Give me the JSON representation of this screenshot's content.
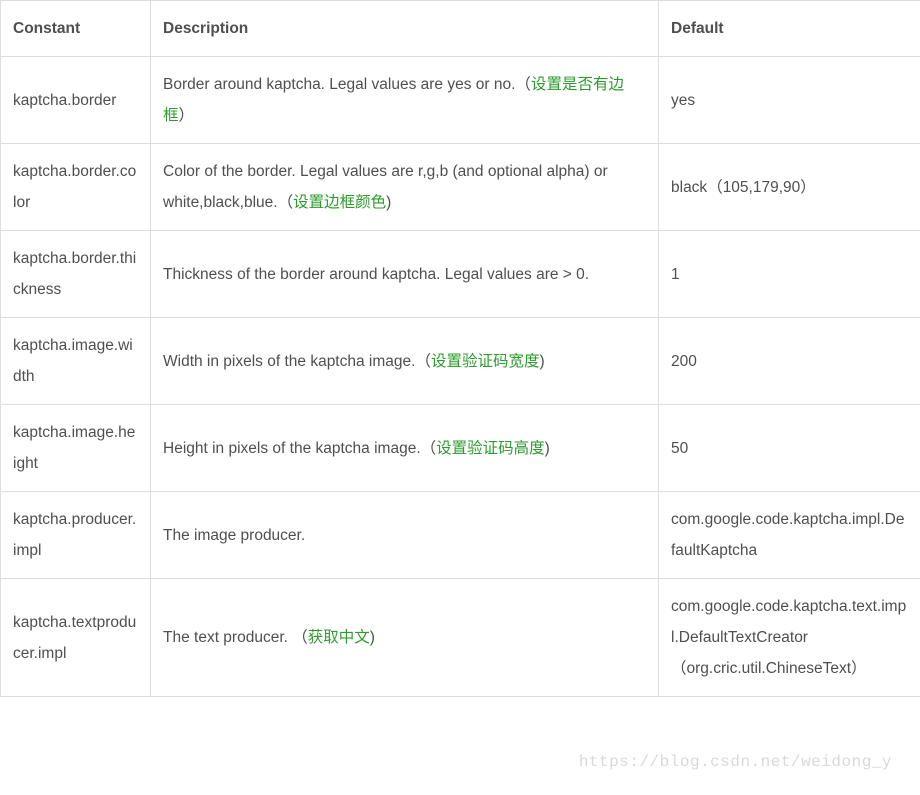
{
  "headers": {
    "constant": "Constant",
    "description": "Description",
    "default": "Default"
  },
  "rows": [
    {
      "constant": "kaptcha.border",
      "desc_text": "Border around kaptcha. Legal values are yes or no.",
      "desc_note_prefix": "（",
      "desc_note": "设置是否有边框",
      "desc_note_suffix": "）",
      "default_text": "yes",
      "default_note": ""
    },
    {
      "constant": "kaptcha.border.color",
      "desc_text": "Color of the border. Legal values are r,g,b (and optional alpha) or white,black,blue.",
      "desc_note_prefix": "（",
      "desc_note": "设置边框颜色",
      "desc_note_suffix": ")",
      "default_text": "black",
      "default_note": "（105,179,90）"
    },
    {
      "constant": "kaptcha.border.thickness",
      "desc_text": "Thickness of the border around kaptcha. Legal values are > 0.",
      "desc_note_prefix": "",
      "desc_note": "",
      "desc_note_suffix": "",
      "default_text": "1",
      "default_note": ""
    },
    {
      "constant": "kaptcha.image.width",
      "desc_text": "Width in pixels of the kaptcha image.",
      "desc_note_prefix": "（",
      "desc_note": "设置验证码宽度",
      "desc_note_suffix": ")",
      "default_text": "200",
      "default_note": ""
    },
    {
      "constant": "kaptcha.image.height",
      "desc_text": "Height in pixels of the kaptcha image.",
      "desc_note_prefix": "（",
      "desc_note": "设置验证码高度",
      "desc_note_suffix": ")",
      "default_text": "50",
      "default_note": ""
    },
    {
      "constant": "kaptcha.producer.impl",
      "desc_text": "The image producer.",
      "desc_note_prefix": "",
      "desc_note": "",
      "desc_note_suffix": "",
      "default_text": "com.google.code.kaptcha.impl.DefaultKaptcha",
      "default_note": ""
    },
    {
      "constant": "kaptcha.textproducer.impl",
      "desc_text": "The text producer.",
      "desc_note_prefix": "  （",
      "desc_note": "获取中文",
      "desc_note_suffix": ")",
      "default_text": "com.google.code.kaptcha.text.impl.DefaultTextCreator",
      "default_note": "  （org.cric.util.ChineseText）"
    }
  ],
  "watermark": "https://blog.csdn.net/weidong_y"
}
